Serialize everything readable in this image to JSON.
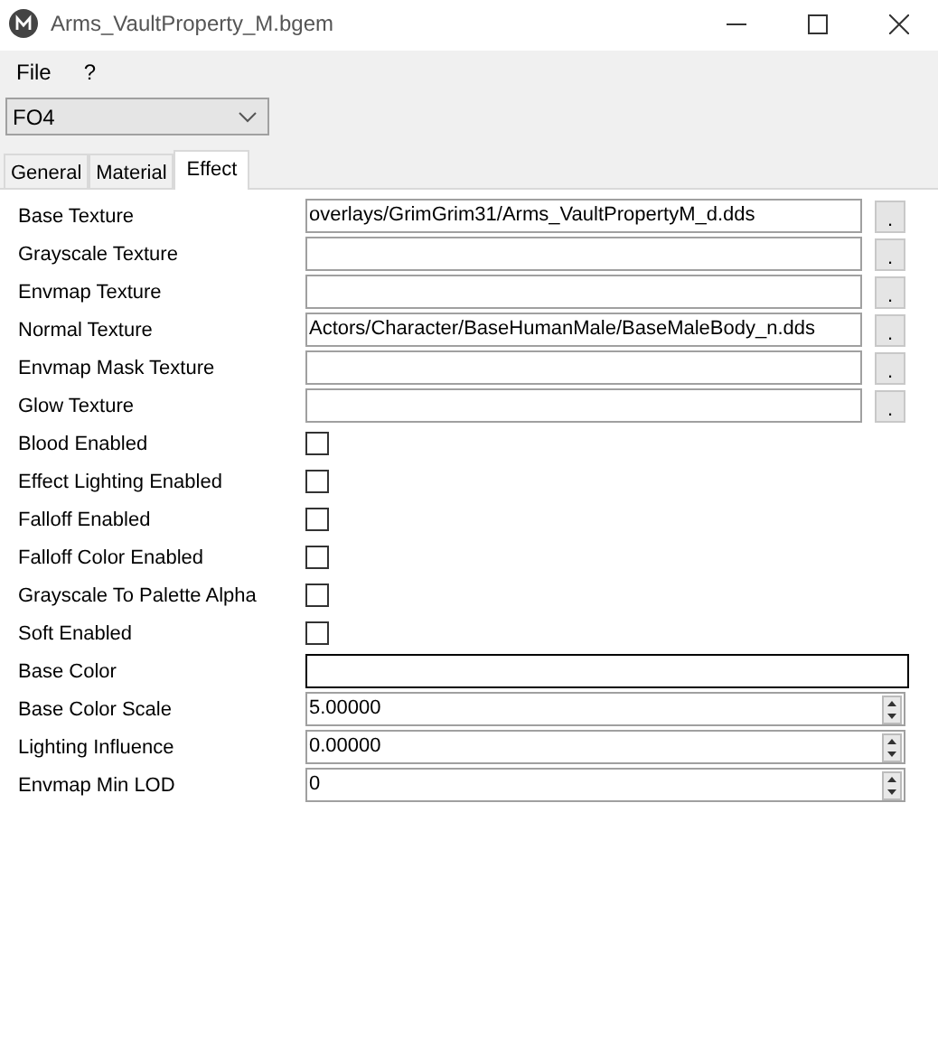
{
  "window": {
    "title": "Arms_VaultProperty_M.bgem"
  },
  "menu": [
    "File",
    "?"
  ],
  "game_select": {
    "value": "FO4"
  },
  "tabs": [
    {
      "label": "General",
      "selected": false
    },
    {
      "label": "Material",
      "selected": false
    },
    {
      "label": "Effect",
      "selected": true
    }
  ],
  "rows": [
    {
      "kind": "texture",
      "label": "Base Texture",
      "value": "overlays/GrimGrim31/Arms_VaultPropertyM_d.dds",
      "button": "."
    },
    {
      "kind": "texture",
      "label": "Grayscale Texture",
      "button": "."
    },
    {
      "kind": "texture",
      "label": "Envmap Texture",
      "button": "."
    },
    {
      "kind": "texture",
      "label": "Normal Texture",
      "value": "Actors/Character/BaseHumanMale/BaseMaleBody_n.dds",
      "button": "."
    },
    {
      "kind": "texture",
      "label": "Envmap Mask Texture",
      "button": "."
    },
    {
      "kind": "texture",
      "label": "Glow Texture",
      "button": "."
    },
    {
      "kind": "checkbox",
      "label": "Blood Enabled",
      "checked": false
    },
    {
      "kind": "checkbox",
      "label": "Effect Lighting Enabled",
      "checked": false
    },
    {
      "kind": "checkbox",
      "label": "Falloff Enabled",
      "checked": false
    },
    {
      "kind": "checkbox",
      "label": "Falloff Color Enabled",
      "checked": false
    },
    {
      "kind": "checkbox",
      "label": "Grayscale To Palette Alpha",
      "checked": false
    },
    {
      "kind": "checkbox",
      "label": "Soft Enabled",
      "checked": false
    },
    {
      "kind": "color",
      "label": "Base Color",
      "color": "#ffffff"
    },
    {
      "kind": "spin",
      "label": "Base Color Scale",
      "value": "5.00000"
    },
    {
      "kind": "spin",
      "label": "Lighting Influence",
      "value": "0.00000"
    },
    {
      "kind": "spin",
      "label": "Envmap Min LOD",
      "value": "0"
    }
  ]
}
